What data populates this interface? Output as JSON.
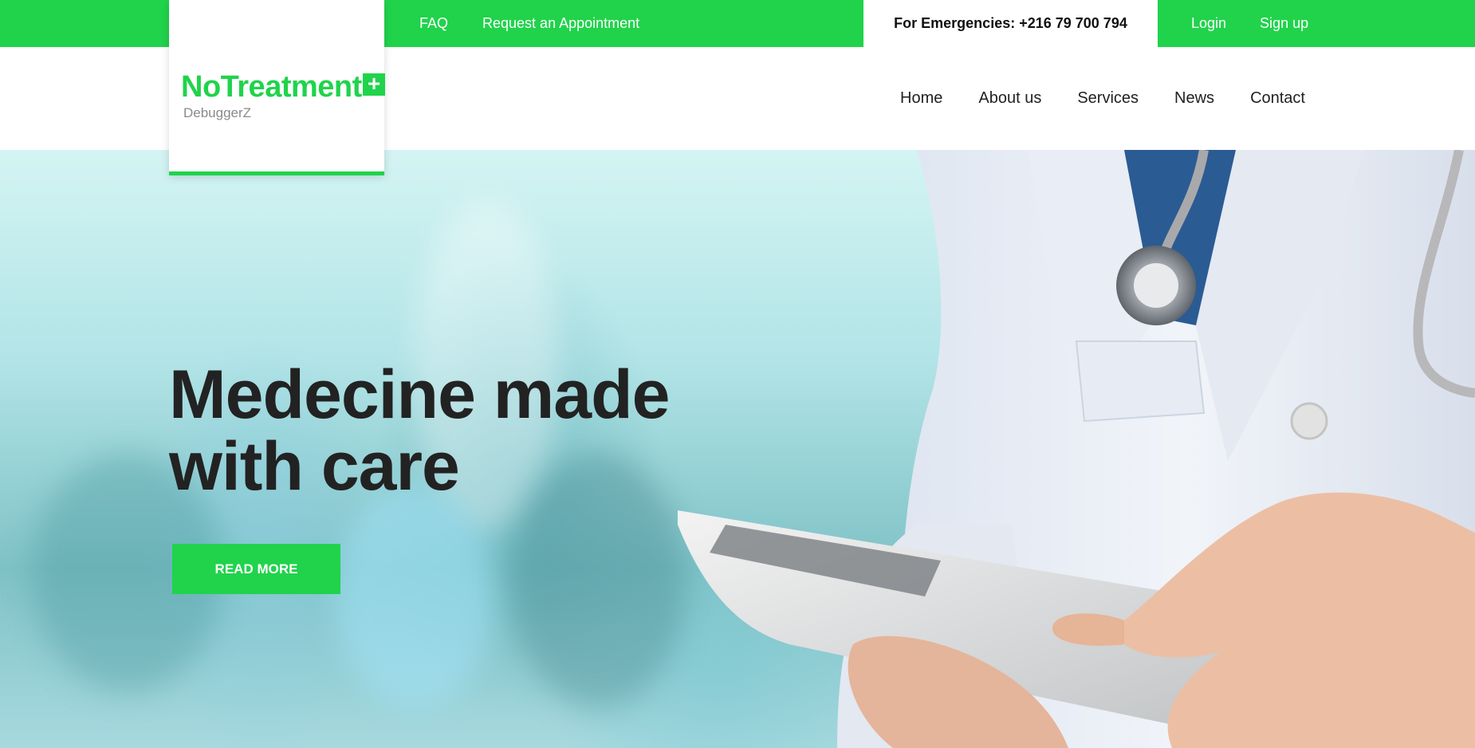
{
  "topbar": {
    "links": [
      "FAQ",
      "Request an Appointment"
    ],
    "emergency": "For Emergencies: +216 79 700 794",
    "login": "Login",
    "signup": "Sign up"
  },
  "logo": {
    "title": "NoTreatment",
    "plus": "+",
    "subtitle": "DebuggerZ"
  },
  "nav": {
    "items": [
      "Home",
      "About us",
      "Services",
      "News",
      "Contact"
    ]
  },
  "hero": {
    "headline_line1": "Medecine made",
    "headline_line2": "with care",
    "button": "READ MORE"
  },
  "colors": {
    "accent": "#20d34b",
    "headline": "#222222",
    "text": "#222222",
    "subtitle": "#8a8a8a"
  }
}
